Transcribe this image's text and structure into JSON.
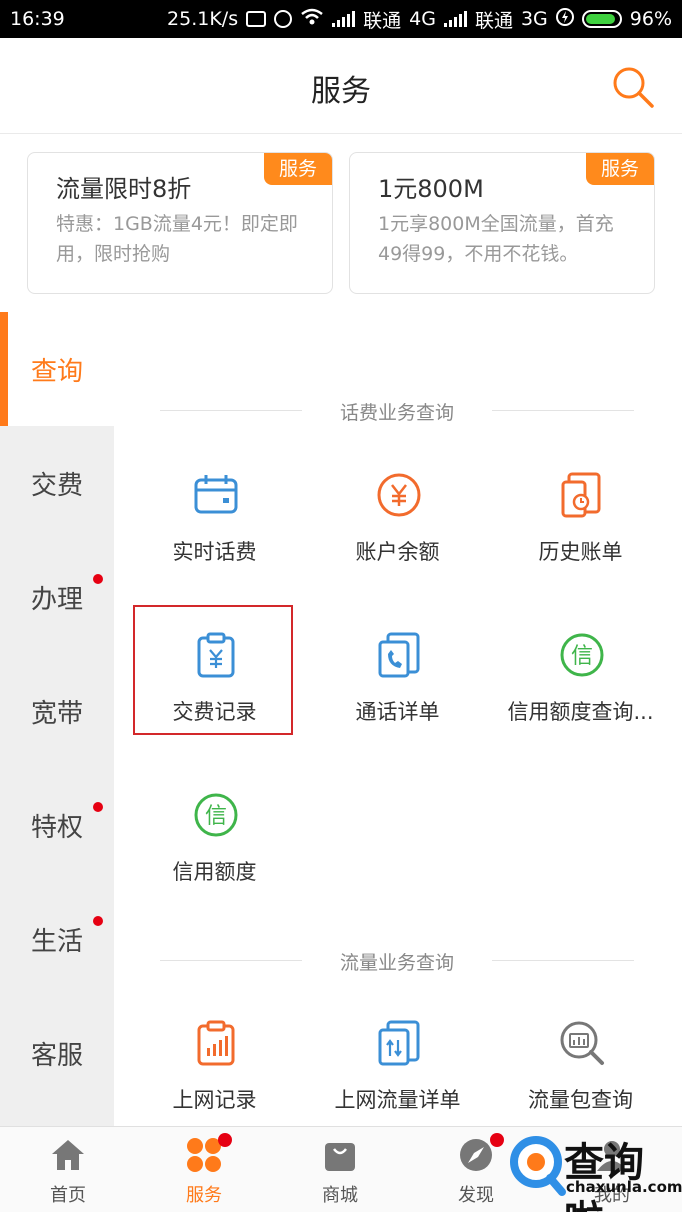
{
  "status_bar": {
    "time": "16:39",
    "speed": "25.1K/s",
    "carrier1": "联通",
    "network1": "4G",
    "carrier2": "联通",
    "network2": "3G",
    "battery": "96%"
  },
  "header": {
    "title": "服务",
    "search_icon": "search-icon"
  },
  "promos": [
    {
      "badge": "服务",
      "title": "流量限时8折",
      "desc": "特惠：1GB流量4元！即定即用，限时抢购"
    },
    {
      "badge": "服务",
      "title": "1元800M",
      "desc": "1元享800M全国流量，首充49得99，不用不花钱。"
    }
  ],
  "rail": [
    {
      "label": "查询",
      "active": true,
      "dot": false
    },
    {
      "label": "交费",
      "active": false,
      "dot": false
    },
    {
      "label": "办理",
      "active": false,
      "dot": true
    },
    {
      "label": "宽带",
      "active": false,
      "dot": false
    },
    {
      "label": "特权",
      "active": false,
      "dot": true
    },
    {
      "label": "生活",
      "active": false,
      "dot": true
    },
    {
      "label": "客服",
      "active": false,
      "dot": false
    }
  ],
  "sections": [
    {
      "heading": "话费业务查询",
      "items": [
        {
          "label": "实时话费",
          "icon": "calendar-icon"
        },
        {
          "label": "账户余额",
          "icon": "yuan-coin-icon"
        },
        {
          "label": "历史账单",
          "icon": "bill-history-icon"
        },
        {
          "label": "交费记录",
          "icon": "payment-record-icon"
        },
        {
          "label": "通话详单",
          "icon": "call-detail-icon"
        },
        {
          "label": "信用额度查询...",
          "icon": "credit-icon"
        },
        {
          "label": "信用额度",
          "icon": "credit-icon"
        }
      ]
    },
    {
      "heading": "流量业务查询",
      "items": [
        {
          "label": "上网记录",
          "icon": "data-record-icon"
        },
        {
          "label": "上网流量详单",
          "icon": "data-detail-icon"
        },
        {
          "label": "流量包查询",
          "icon": "package-search-icon"
        }
      ]
    }
  ],
  "bottom_nav": [
    {
      "label": "首页",
      "icon": "home-icon",
      "active": false
    },
    {
      "label": "服务",
      "icon": "service-icon",
      "active": true
    },
    {
      "label": "商城",
      "icon": "shop-icon",
      "active": false
    },
    {
      "label": "发现",
      "icon": "compass-icon",
      "active": false
    },
    {
      "label": "我的",
      "icon": "profile-icon",
      "active": false
    }
  ],
  "watermark": {
    "title": "查询啦",
    "site": "chaxunla.com"
  },
  "colors": {
    "accent": "#ff7a1a",
    "badge": "#ff8a1c",
    "blue": "#3b8fd6",
    "green": "#3fb54a",
    "red_dot": "#e60012",
    "highlight_border": "#d3282a"
  }
}
